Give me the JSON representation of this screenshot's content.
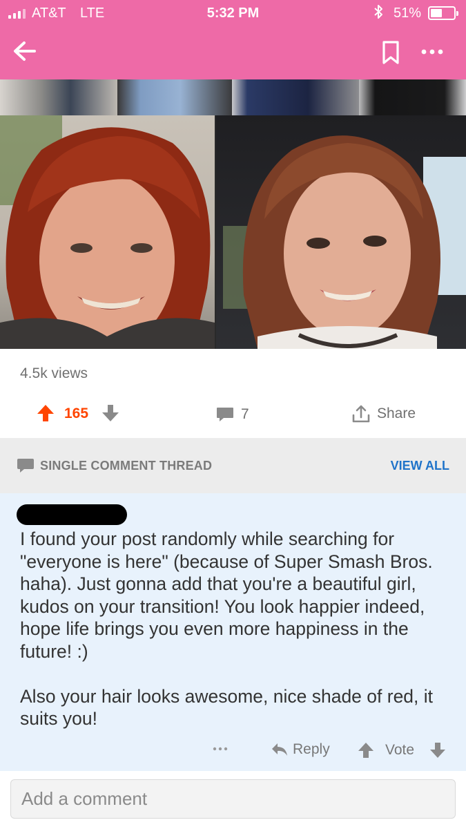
{
  "status_bar": {
    "carrier": "AT&T",
    "network": "LTE",
    "time": "5:32 PM",
    "battery_percent": "51%",
    "battery_level": 0.51,
    "icons": [
      "signal-bars-icon",
      "bluetooth-icon",
      "battery-icon"
    ]
  },
  "nav": {
    "icons": [
      "back-arrow-icon",
      "bookmark-icon",
      "more-dots-icon"
    ]
  },
  "colors": {
    "header": "#ee6aa7",
    "upvote": "#ff4500",
    "link": "#1f73c9",
    "comment_bg": "#e8f2fc",
    "thread_bar_bg": "#ececec"
  },
  "post": {
    "views": "4.5k views",
    "score": "165",
    "comment_count": "7",
    "share_label": "Share"
  },
  "thread": {
    "title": "SINGLE COMMENT THREAD",
    "view_all": "VIEW ALL"
  },
  "comment": {
    "paragraphs": [
      "I found your post randomly while searching for \"everyone is here\" (because of Super Smash Bros. haha). Just gonna add that you're a beautiful girl, kudos on your transition! You look happier indeed, hope life brings you even more happiness in the future! :)",
      "Also your hair looks awesome, nice shade of red, it suits you!"
    ],
    "reply_label": "Reply",
    "vote_label": "Vote"
  },
  "composer": {
    "placeholder": "Add a comment"
  }
}
